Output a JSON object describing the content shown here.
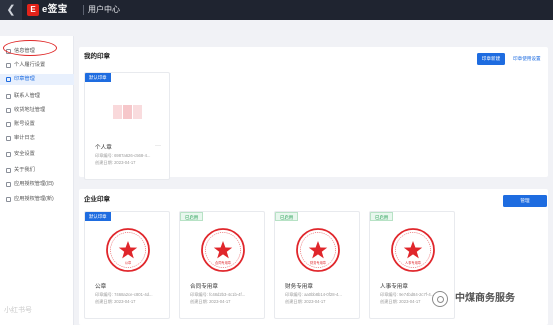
{
  "topbar": {
    "back_icon": "chevron-left-icon",
    "logo_badge": "E",
    "logo": "e签宝",
    "title": "用户中心"
  },
  "sidebar": {
    "items": [
      {
        "label": "信息管理",
        "active": false
      },
      {
        "label": "个人履行设置",
        "active": false
      },
      {
        "label": "印章管理",
        "active": true
      },
      {
        "label": "联系人管理",
        "active": false
      },
      {
        "label": "收货地址管理",
        "active": false
      },
      {
        "label": "账号设置",
        "active": false
      },
      {
        "label": "审计日志",
        "active": false
      },
      {
        "label": "安全设置",
        "active": false
      },
      {
        "label": "关于我们",
        "active": false
      },
      {
        "label": "应用授权管理(旧)",
        "active": false
      },
      {
        "label": "应用授权管理(新)",
        "active": false
      }
    ]
  },
  "my_seals": {
    "title": "我的印章",
    "create_button": "印章新建",
    "settings_link": "印章使用设置",
    "items": [
      {
        "tag": "默认印章",
        "tag_style": "blue",
        "name": "个人章",
        "more": "···",
        "seal_id": "印章编号: 6987a626-c568-4...",
        "created": "创建日期: 2023-04-17"
      }
    ]
  },
  "company_seals": {
    "title": "企业印章",
    "manage_button": "管理",
    "items": [
      {
        "tag": "默认印章",
        "tag_style": "blue",
        "name": "公章",
        "seal_id": "印章编号: 7468a2ce-c801-4d...",
        "created": "创建日期: 2023-04-17",
        "seal_label": "公章"
      },
      {
        "tag": "已启用",
        "tag_style": "green",
        "name": "合同专用章",
        "seal_id": "印章编号: fc48d2b3-4c1b-4f...",
        "created": "创建日期: 2023-04-17",
        "seal_label": "合同专用章"
      },
      {
        "tag": "已启用",
        "tag_style": "green",
        "name": "财务专用章",
        "seal_id": "印章编号: aa0bb8b14-0f28-4...",
        "created": "创建日期: 2023-04-17",
        "seal_label": "财务专用章"
      },
      {
        "tag": "已启用",
        "tag_style": "green",
        "name": "人事专用章",
        "seal_id": "印章编号: 9e74bd84-2c7f-4...",
        "created": "创建日期: 2023-04-17",
        "seal_label": "人事专用章"
      }
    ]
  },
  "watermarks": {
    "left": "小红书号",
    "right": "中煤商务服务"
  },
  "colors": {
    "accent": "#1e6ce0",
    "seal_red": "#e0262b",
    "topbar": "#1f2430",
    "highlight_oval": "#e02a2a"
  }
}
